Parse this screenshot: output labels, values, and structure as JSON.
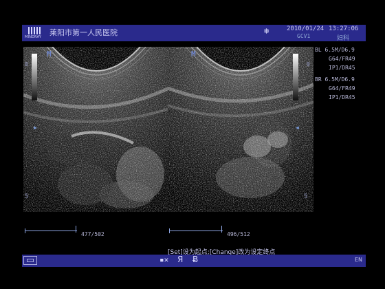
{
  "header": {
    "logo_text": "MINDRAY",
    "hospital": "莱阳市第一人民医院",
    "date": "2010/01/24",
    "time": "13:27:06",
    "preset": "GCV1",
    "department": "妇科"
  },
  "left_panel": {
    "probe_mark": "M",
    "depth_top": "0",
    "depth_mid": "5",
    "cine_count": "477/502"
  },
  "right_panel": {
    "probe_mark": "M",
    "depth_top": "0",
    "depth_mid": "5",
    "cine_count": "496/512"
  },
  "params": {
    "bl_line1": "BL 6.5M/D6.9",
    "bl_line2": "G64/FR49",
    "bl_line3": "IP1/DR45",
    "br_line1": "BR 6.5M/D6.9",
    "br_line2": "G64/FR49",
    "br_line3": "IP1/DR45"
  },
  "hint": "[Set]设为起点;[Change]改为设定终点",
  "footer": {
    "ya_label": "Я",
    "b_label": "Ƀ",
    "lang": "EN"
  },
  "icons": {
    "freeze": "snowflake-icon",
    "keyboard": "keyboard-icon",
    "mouse": "mouse-icon"
  },
  "colors": {
    "header_bg": "#2a2a8c",
    "text": "#c8c8e6",
    "accent": "#8ea6e4"
  }
}
